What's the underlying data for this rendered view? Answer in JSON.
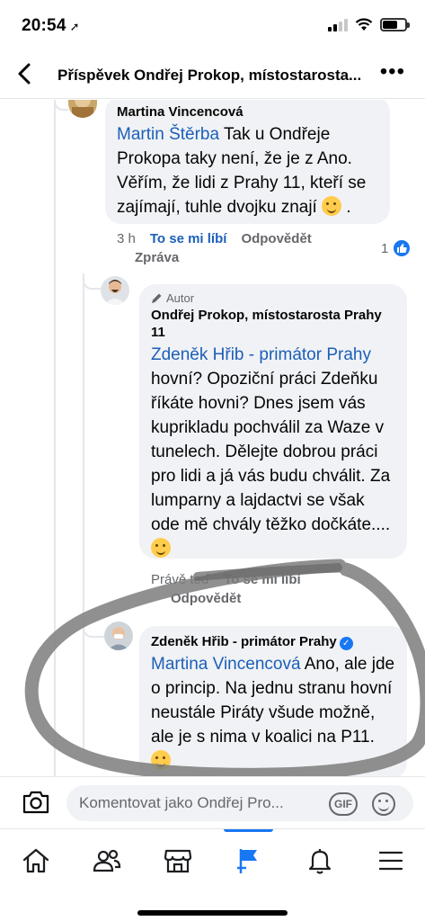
{
  "status_bar": {
    "time": "20:54",
    "location_glyph": "➚"
  },
  "header": {
    "back_glyph": "‹",
    "title": "Příspěvek Ondřej Prokop, místostarosta...",
    "more_glyph": "•••"
  },
  "comments": [
    {
      "author": "Martina Vincencová",
      "mention": "Martin Štěrba",
      "text": " Tak u Ondřeje Prokopa taky není, že je z Ano. Věřím, že lidi z Prahy 11, kteří se zajímají, tuhle dvojku znají",
      "text_end": " .",
      "time": "3 h",
      "like_label": "To se mi líbí",
      "reply_label": "Odpovědět",
      "message_label": "Zpráva",
      "reactions_count": "1"
    },
    {
      "badge": "Autor",
      "author": "Ondřej Prokop, místostarosta Prahy 11",
      "mention": "Zdeněk Hřib - primátor Prahy",
      "text": " hovní? Opoziční práci Zdeňku říkáte hovni? Dnes jsem vás kuprikladu pochválil za Waze v tunelech. Dělejte dobrou práci pro lidi a já vás budu chválit. Za lumparny a lajdactvi se však ode mě chvály těžko dočkáte....",
      "time": "Právě teď",
      "like_label": "To se mi líbí",
      "reply_label": "Odpovědět"
    },
    {
      "author": "Zdeněk Hřib - primátor Prahy",
      "mention": "Martina Vincencová",
      "text": " Ano, ale jde o princip. Na jednu stranu hovní neustále Piráty všude možně, ale je s nima v koalici na P11."
    }
  ],
  "composer": {
    "placeholder": "Komentovat jako Ondřej Pro...",
    "gif_label": "GIF"
  },
  "nav": [
    "home-icon",
    "friends-icon",
    "marketplace-icon",
    "pages-flag-icon",
    "notifications-bell-icon",
    "menu-icon"
  ],
  "colors": {
    "accent": "#1877f2",
    "mention": "#1c5fb8",
    "bubble": "#f0f2f5",
    "secondary_text": "#65676b"
  }
}
